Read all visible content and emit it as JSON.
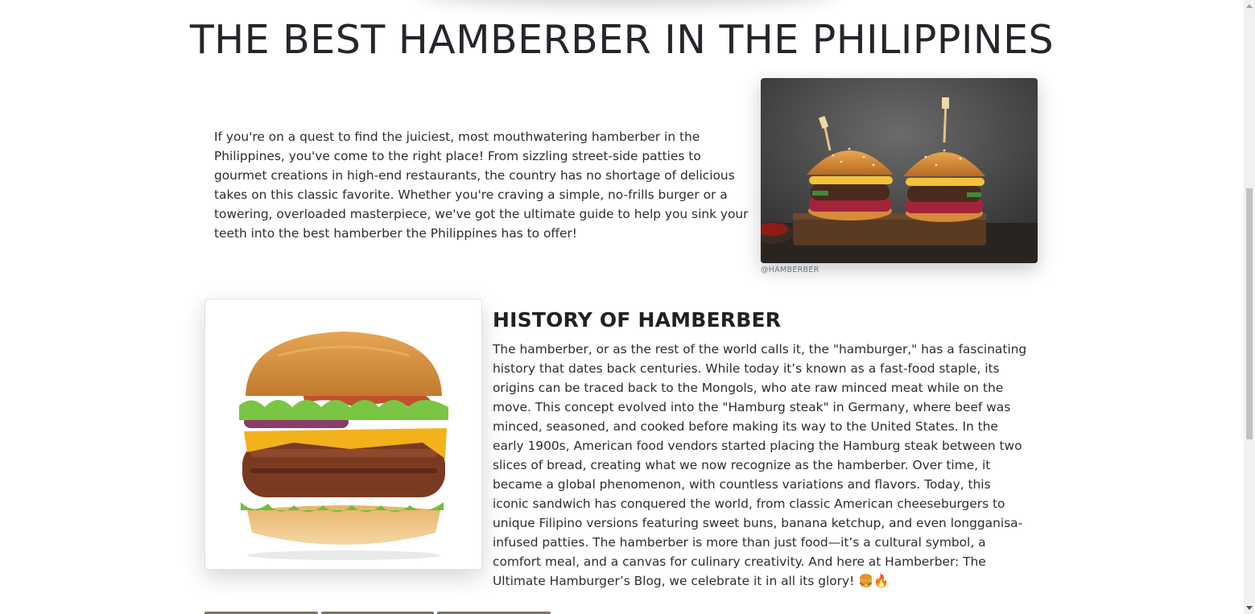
{
  "page": {
    "title": "THE BEST HAMBERBER IN THE PHILIPPINES"
  },
  "intro": {
    "text": "If you're on a quest to find the juiciest, most mouthwatering hamberber in the Philippines, you've come to the right place! From sizzling street-side patties to gourmet creations in high-end restaurants, the country has no shortage of delicious takes on this classic favorite. Whether you're craving a simple, no-frills burger or a towering, overloaded masterpiece, we've got the ultimate guide to help you sink your teeth into the best hamberber the Philippines has to offer!",
    "image_caption": "@HAMBERBER"
  },
  "history": {
    "heading": "HISTORY OF HAMBERBER",
    "text": "The hamberber, or as the rest of the world calls it, the \"hamburger,\" has a fascinating history that dates back centuries. While today it’s known as a fast-food staple, its origins can be traced back to the Mongols, who ate raw minced meat while on the move. This concept evolved into the \"Hamburg steak\" in Germany, where beef was minced, seasoned, and cooked before making its way to the United States. In the early 1900s, American food vendors started placing the Hamburg steak between two slices of bread, creating what we now recognize as the hamberber. Over time, it became a global phenomenon, with countless variations and flavors. Today, this iconic sandwich has conquered the world, from classic American cheeseburgers to unique Filipino versions featuring sweet buns, banana ketchup, and even longganisa-infused patties. The hamberber is more than just food—it’s a cultural symbol, a comfort meal, and a canvas for culinary creativity. And here at Hamberber: The Ultimate Hamburger’s Blog, we celebrate it in all its glory! 🍔🔥"
  },
  "icons": {
    "intro_photo": "two-burgers-photo",
    "history_photo": "cheeseburger-photo"
  }
}
